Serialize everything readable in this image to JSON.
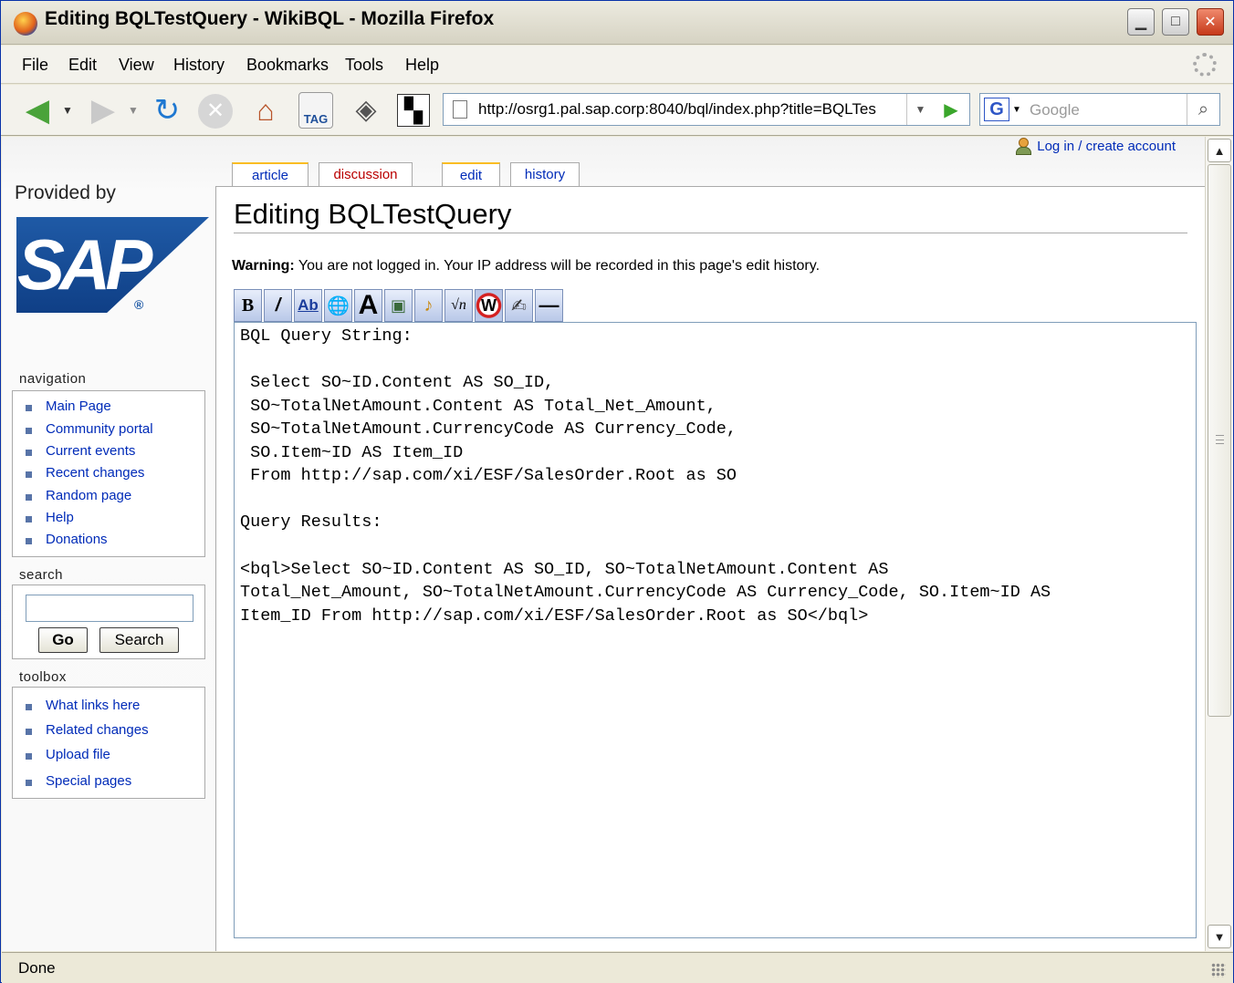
{
  "window": {
    "title": "Editing BQLTestQuery - WikiBQL - Mozilla Firefox",
    "minimize": "▁",
    "maximize": "□",
    "close": "✕"
  },
  "menubar": {
    "items": [
      {
        "label": "File"
      },
      {
        "label": "Edit"
      },
      {
        "label": "View"
      },
      {
        "label": "History"
      },
      {
        "label": "Bookmarks"
      },
      {
        "label": "Tools"
      },
      {
        "label": "Help"
      }
    ]
  },
  "navbar": {
    "icons": [
      "back-icon",
      "forward-icon",
      "reload-icon",
      "stop-icon",
      "home-icon",
      "tag-icon",
      "bookmark-icon",
      "qr-icon"
    ],
    "tag_label": "TAG",
    "url": "http://osrg1.pal.sap.corp:8040/bql/index.php?title=BQLTes",
    "search_placeholder": "Google",
    "search_engine": "G"
  },
  "page": {
    "personal_link": "Log in / create account",
    "provided_by": "Provided by",
    "logo_text": "SAP",
    "logo_reg": "®",
    "tabs": [
      {
        "label": "article"
      },
      {
        "label": "discussion"
      },
      {
        "label": "edit"
      },
      {
        "label": "history"
      }
    ],
    "title": "Editing BQLTestQuery",
    "warning_label": "Warning:",
    "warning_text": " You are not logged in. Your IP address will be recorded in this page's edit history.",
    "textarea_lines": [
      "BQL Query String:",
      "",
      " Select SO~ID.Content AS SO_ID,",
      " SO~TotalNetAmount.Content AS Total_Net_Amount,",
      " SO~TotalNetAmount.CurrencyCode AS Currency_Code,",
      " SO.Item~ID AS Item_ID",
      " From http://sap.com/xi/ESF/SalesOrder.Root as SO",
      "",
      "Query Results:",
      "",
      "<bql>Select SO~ID.Content AS SO_ID, SO~TotalNetAmount.Content AS",
      "Total_Net_Amount, SO~TotalNetAmount.CurrencyCode AS Currency_Code, SO.Item~ID AS",
      "Item_ID From http://sap.com/xi/ESF/SalesOrder.Root as SO</bql>"
    ]
  },
  "sidebar": {
    "navigation_heading": "navigation",
    "navigation": [
      "Main Page",
      "Community portal",
      "Current events",
      "Recent changes",
      "Random page",
      "Help",
      "Donations"
    ],
    "search_heading": "search",
    "go_label": "Go",
    "search_label": "Search",
    "toolbox_heading": "toolbox",
    "toolbox": [
      "What links here",
      "Related changes",
      "Upload file",
      "Special pages"
    ]
  },
  "edit_toolbar": {
    "buttons": [
      {
        "name": "bold-button",
        "glyph": "B"
      },
      {
        "name": "italic-button",
        "glyph": "/"
      },
      {
        "name": "internal-link-button",
        "glyph": "Ab"
      },
      {
        "name": "external-link-button",
        "glyph": "🌐"
      },
      {
        "name": "headline-button",
        "glyph": "A"
      },
      {
        "name": "image-button",
        "glyph": "▣"
      },
      {
        "name": "media-button",
        "glyph": "♪"
      },
      {
        "name": "math-button",
        "glyph": "√n"
      },
      {
        "name": "nowiki-button",
        "glyph": "W"
      },
      {
        "name": "signature-button",
        "glyph": "✍"
      },
      {
        "name": "horizontal-line-button",
        "glyph": "—"
      }
    ]
  },
  "statusbar": {
    "text": "Done"
  },
  "colors": {
    "link": "#002bb8",
    "new_link": "#ba0000",
    "selected_tab_accent": "#fabd23",
    "sap_blue": "#1f5aa6"
  }
}
